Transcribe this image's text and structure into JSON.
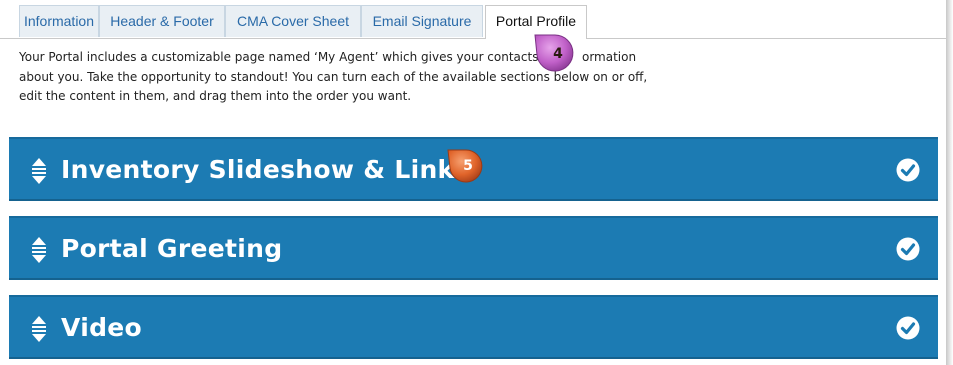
{
  "tabs": [
    {
      "label": "Information",
      "active": false
    },
    {
      "label": "Header & Footer",
      "active": false
    },
    {
      "label": "CMA Cover Sheet",
      "active": false
    },
    {
      "label": "Email Signature",
      "active": false
    },
    {
      "label": "Portal Profile",
      "active": true
    }
  ],
  "intro": {
    "line1": "Your Portal includes a customizable page named ‘My Agent’ which gives your contacts m",
    "line1_end": "ormation",
    "line2": "about you. Take the opportunity to standout! You can turn each of the available sections below on or off,",
    "line3": "edit the content in them, and drag them into the order you want."
  },
  "sections": [
    {
      "title": "Inventory Slideshow & Links",
      "enabled": true,
      "icon": "drag-handle-icon",
      "status_icon": "check-circle-icon"
    },
    {
      "title": "Portal Greeting",
      "enabled": true,
      "icon": "drag-handle-icon",
      "status_icon": "check-circle-icon"
    },
    {
      "title": "Video",
      "enabled": true,
      "icon": "drag-handle-icon",
      "status_icon": "check-circle-icon"
    }
  ],
  "markers": [
    {
      "number": "4",
      "color": "#c060c8"
    },
    {
      "number": "5",
      "color": "#e0642a"
    }
  ],
  "colors": {
    "accent": "#1c7bb3",
    "tab_text": "#2a6aa8",
    "tab_bg": "#e9eff4"
  }
}
